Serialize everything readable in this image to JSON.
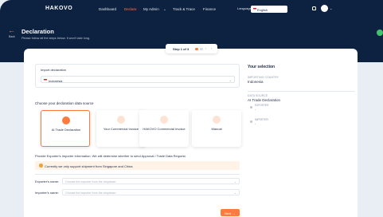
{
  "nav": {
    "logo": "HAKOVO",
    "items": [
      {
        "label": "Dashboard"
      },
      {
        "label": "Declare"
      },
      {
        "label": "My Admin"
      },
      {
        "label": "Track & Trace"
      },
      {
        "label": "Finance"
      }
    ],
    "admin_chevron": "⌄",
    "language_label": "Language",
    "language_value": "English"
  },
  "header": {
    "back_label": "Back",
    "title": "Declaration",
    "subtitle": "Please follow all the steps below. It won't take long."
  },
  "stepper": {
    "label": "Step 1 of 3",
    "prev": "‹",
    "next": "›"
  },
  "import_box": {
    "label": "Import declaration",
    "country_value": "Indonesia"
  },
  "source": {
    "title": "Choose your declaration data source",
    "options": [
      {
        "label": "AI Trade Declaration",
        "selected": true
      },
      {
        "label": "Your Commercial Invoice",
        "selected": false
      },
      {
        "label": "HAKOVO Commercial Invoice",
        "selected": false
      },
      {
        "label": "Manual",
        "selected": false
      }
    ],
    "check_mark": "✓"
  },
  "info": {
    "text": "Provide Exporter's Importer information. We will determine whether to send Approval / Trade Data Request.",
    "notice": "Currently we only support shipment from Singapore and China"
  },
  "form": {
    "exporter_label": "Exporter's name:",
    "exporter_placeholder": "Choose the exporter from the dropdown",
    "importer_label": "Importer's name:",
    "importer_placeholder": "Choose the importer from the dropdown"
  },
  "next_button": "Next",
  "next_arrow": "→",
  "selection": {
    "title": "Your selection",
    "country_heading": "IMPORTING COUNTRY",
    "country_value": "Indonesia",
    "source_heading": "DATA SOURCE",
    "source_value": "AI Trade Declaration",
    "exporter_heading": "EXPORTER",
    "exporter_value": "-",
    "importer_heading": "IMPORTER",
    "importer_value": "-"
  },
  "colors": {
    "nav_bg": "#0d2240",
    "accent": "#ff7a3d",
    "success": "#3fc36b"
  }
}
